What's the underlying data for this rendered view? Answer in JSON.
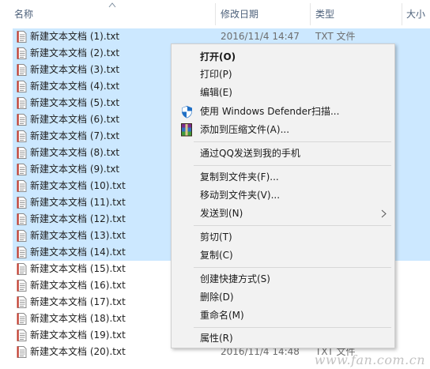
{
  "columns": {
    "name": "名称",
    "date": "修改日期",
    "type": "类型",
    "size": "大小"
  },
  "files": [
    {
      "name": "新建文本文档 (1).txt",
      "date": "2016/11/4 14:47",
      "type": "TXT 文件",
      "selected": true
    },
    {
      "name": "新建文本文档 (2).txt",
      "date": "",
      "type": "",
      "selected": true
    },
    {
      "name": "新建文本文档 (3).txt",
      "date": "",
      "type": "",
      "selected": true
    },
    {
      "name": "新建文本文档 (4).txt",
      "date": "",
      "type": "",
      "selected": true
    },
    {
      "name": "新建文本文档 (5).txt",
      "date": "",
      "type": "",
      "selected": true
    },
    {
      "name": "新建文本文档 (6).txt",
      "date": "",
      "type": "",
      "selected": true
    },
    {
      "name": "新建文本文档 (7).txt",
      "date": "",
      "type": "",
      "selected": true
    },
    {
      "name": "新建文本文档 (8).txt",
      "date": "",
      "type": "",
      "selected": true
    },
    {
      "name": "新建文本文档 (9).txt",
      "date": "",
      "type": "",
      "selected": true
    },
    {
      "name": "新建文本文档 (10).txt",
      "date": "",
      "type": "",
      "selected": true
    },
    {
      "name": "新建文本文档 (11).txt",
      "date": "",
      "type": "",
      "selected": true
    },
    {
      "name": "新建文本文档 (12).txt",
      "date": "",
      "type": "",
      "selected": true
    },
    {
      "name": "新建文本文档 (13).txt",
      "date": "",
      "type": "",
      "selected": true
    },
    {
      "name": "新建文本文档 (14).txt",
      "date": "",
      "type": "",
      "selected": true
    },
    {
      "name": "新建文本文档 (15).txt",
      "date": "",
      "type": "",
      "selected": false
    },
    {
      "name": "新建文本文档 (16).txt",
      "date": "",
      "type": "",
      "selected": false
    },
    {
      "name": "新建文本文档 (17).txt",
      "date": "",
      "type": "",
      "selected": false
    },
    {
      "name": "新建文本文档 (18).txt",
      "date": "",
      "type": "",
      "selected": false
    },
    {
      "name": "新建文本文档 (19).txt",
      "date": "",
      "type": "",
      "selected": false
    },
    {
      "name": "新建文本文档 (20).txt",
      "date": "2016/11/4 14:48",
      "type": "TXT 文件",
      "selected": false
    }
  ],
  "context_menu": {
    "open": "打开(O)",
    "print": "打印(P)",
    "edit": "编辑(E)",
    "defender_scan": "使用 Windows Defender扫描...",
    "add_to_archive": "添加到压缩文件(A)...",
    "send_qq": "通过QQ发送到我的手机",
    "copy_to_folder": "复制到文件夹(F)...",
    "move_to_folder": "移动到文件夹(V)...",
    "send_to": "发送到(N)",
    "cut": "剪切(T)",
    "copy": "复制(C)",
    "create_shortcut": "创建快捷方式(S)",
    "delete": "删除(D)",
    "rename": "重命名(M)",
    "properties": "属性(R)"
  },
  "icons": {
    "file": "text-file-icon",
    "defender": "shield-icon",
    "archive": "winrar-icon",
    "submenu": "chevron-right-icon"
  },
  "watermark": "www.fan.com.cn",
  "colors": {
    "selection": "#cce8ff",
    "menu_bg": "#f2f2f2",
    "header_text": "#4c607a"
  }
}
